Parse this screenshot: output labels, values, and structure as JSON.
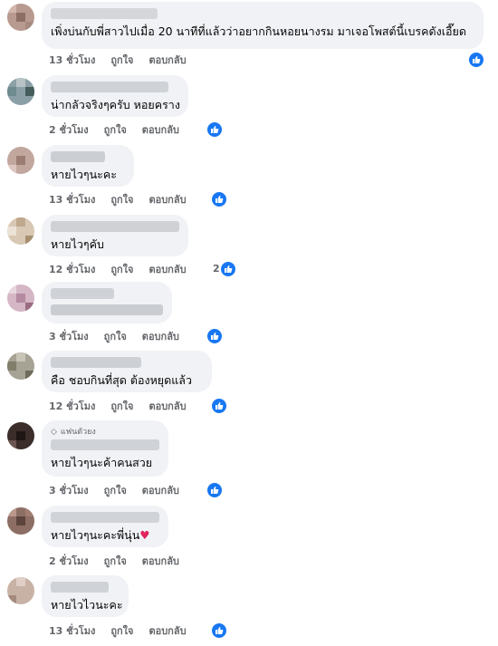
{
  "actions": {
    "like_label": "ถูกใจ",
    "reply_label": "ตอบกลับ"
  },
  "comments": [
    {
      "text": "เพิ่งบ่นกับพี่สาวไปเมื่อ 20 นาทีที่แล้วว่าอยากกินหอยนางรม มาเจอโพสต์นี้เบรคดังเอี๊ยด",
      "time": "13 ชั่วโมง"
    },
    {
      "text": "น่ากลัวจริงๆครับ หอยคราง",
      "time": "2 ชั่วโมง"
    },
    {
      "text": "หายไวๆนะคะ",
      "time": "13 ชั่วโมง"
    },
    {
      "text": "หายไวๆคับ",
      "time": "12 ชั่วโมง",
      "reaction_count": "2"
    },
    {
      "text": "",
      "time": "3 ชั่วโมง"
    },
    {
      "text": "คือ ชอบกินที่สุด ต้องหยุดแล้ว",
      "time": "12 ชั่วโมง"
    },
    {
      "badge": "แฟนตัวยง",
      "text": "หายไวๆนะค้าคนสวย",
      "time": "3 ชั่วโมง"
    },
    {
      "text": "หายไวๆนะคะพี่นุ่น",
      "time": "2 ชั่วโมง"
    },
    {
      "text": "หายไวไวนะคะ",
      "time": "13 ชั่วโมง"
    }
  ]
}
